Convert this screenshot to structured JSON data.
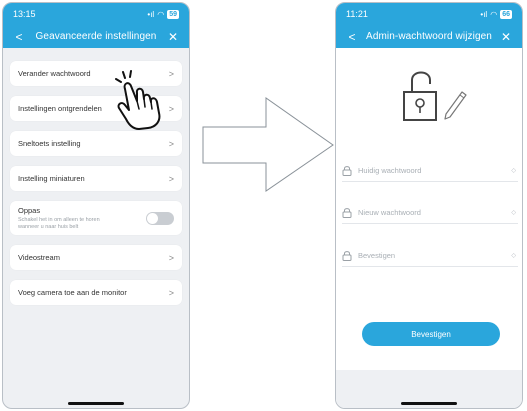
{
  "left_phone": {
    "status": {
      "time": "13:15",
      "signal": "•ıl",
      "wifi": "◠",
      "battery": "59"
    },
    "nav": {
      "back": "<",
      "title": "Geavanceerde instellingen",
      "close": "✕"
    },
    "items": [
      {
        "label": "Verander wachtwoord",
        "chevron": ">"
      },
      {
        "label": "Instellingen ontgrendelen",
        "chevron": ">"
      },
      {
        "label": "Sneltoets instelling",
        "chevron": ">"
      },
      {
        "label": "Instelling miniaturen",
        "chevron": ">"
      }
    ],
    "privacy": {
      "label": "Oppas",
      "description": "Schakel het in om alleen te horen wanneer u naar huis belt",
      "enabled": false
    },
    "items2": [
      {
        "label": "Videostream",
        "chevron": ">"
      },
      {
        "label": "Voeg camera toe aan de monitor",
        "chevron": ">"
      }
    ]
  },
  "right_phone": {
    "status": {
      "time": "11:21",
      "signal": "•ıl",
      "wifi": "◠",
      "battery": "66"
    },
    "nav": {
      "back": "<",
      "title": "Admin-wachtwoord wijzigen",
      "close": "✕"
    },
    "fields": [
      {
        "placeholder": "Huidig wachtwoord",
        "eye": "◇"
      },
      {
        "placeholder": "Nieuw wachtwoord",
        "eye": "◇"
      },
      {
        "placeholder": "Bevestigen",
        "eye": "◇"
      }
    ],
    "confirm_label": "Bevestigen"
  },
  "colors": {
    "accent": "#2aa6dc",
    "background": "#eef0f3"
  }
}
